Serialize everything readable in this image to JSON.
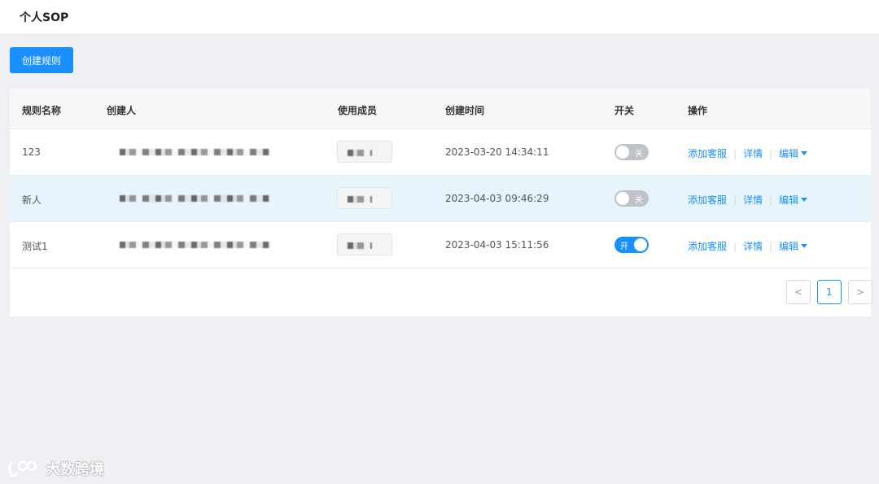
{
  "page": {
    "title": "个人SOP"
  },
  "toolbar": {
    "create_label": "创建规则"
  },
  "table": {
    "columns": [
      "规则名称",
      "创建人",
      "使用成员",
      "创建时间",
      "开关",
      "操作"
    ],
    "rows": [
      {
        "name": "123",
        "created_at": "2023-03-20 14:34:11",
        "enabled": false,
        "switch_label": "关",
        "highlighted": false
      },
      {
        "name": "新人",
        "created_at": "2023-04-03 09:46:29",
        "enabled": false,
        "switch_label": "关",
        "highlighted": true
      },
      {
        "name": "测试1",
        "created_at": "2023-04-03 15:11:56",
        "enabled": true,
        "switch_label": "开",
        "highlighted": false
      }
    ],
    "actions": {
      "add_service": "添加客服",
      "details": "详情",
      "edit": "编辑"
    }
  },
  "pagination": {
    "prev": "<",
    "current": "1",
    "next": ">"
  },
  "watermark": {
    "text": "大数跨境",
    "logo": "ic-logo"
  },
  "colors": {
    "accent": "#1890ff",
    "switch_off": "#bfc3c9",
    "highlight_row": "#e6f4fb"
  }
}
